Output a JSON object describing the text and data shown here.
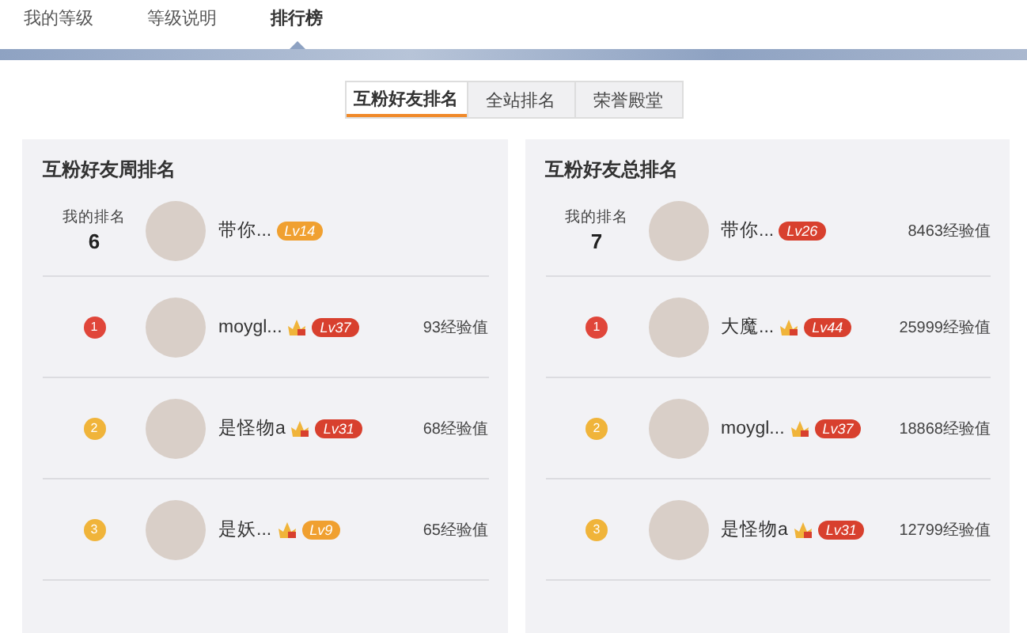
{
  "tabs": [
    {
      "label": "我的等级",
      "selected": false
    },
    {
      "label": "等级说明",
      "selected": false
    },
    {
      "label": "排行榜",
      "selected": true
    }
  ],
  "segments": [
    {
      "label": "互粉好友排名",
      "selected": true
    },
    {
      "label": "全站排名",
      "selected": false
    },
    {
      "label": "荣誉殿堂",
      "selected": false
    }
  ],
  "panels": [
    {
      "title": "互粉好友周排名",
      "my_rank": {
        "label": "我的排名",
        "rank": "6",
        "name": "带你...",
        "level": {
          "text": "Lv14",
          "color": "#f0a030"
        }
      },
      "rows": [
        {
          "rank": {
            "text": "1",
            "color": "#e0463a"
          },
          "name": "moygl...",
          "vip": true,
          "level": {
            "text": "Lv37",
            "color": "#d8402e"
          },
          "exp": "93经验值"
        },
        {
          "rank": {
            "text": "2",
            "color": "#f0b43a"
          },
          "name": "是怪物a",
          "vip": true,
          "level": {
            "text": "Lv31",
            "color": "#d8402e"
          },
          "exp": "68经验值"
        },
        {
          "rank": {
            "text": "3",
            "color": "#f0b43a"
          },
          "name": "是妖...",
          "vip": true,
          "level": {
            "text": "Lv9",
            "color": "#f0a030"
          },
          "exp": "65经验值"
        }
      ]
    },
    {
      "title": "互粉好友总排名",
      "my_rank": {
        "label": "我的排名",
        "rank": "7",
        "name": "带你...",
        "level": {
          "text": "Lv26",
          "color": "#d8402e"
        },
        "exp": "8463经验值"
      },
      "rows": [
        {
          "rank": {
            "text": "1",
            "color": "#e0463a"
          },
          "name": "大魔...",
          "vip": true,
          "level": {
            "text": "Lv44",
            "color": "#d8402e"
          },
          "exp": "25999经验值"
        },
        {
          "rank": {
            "text": "2",
            "color": "#f0b43a"
          },
          "name": "moygl...",
          "vip": true,
          "level": {
            "text": "Lv37",
            "color": "#d8402e"
          },
          "exp": "18868经验值"
        },
        {
          "rank": {
            "text": "3",
            "color": "#f0b43a"
          },
          "name": "是怪物a",
          "vip": true,
          "level": {
            "text": "Lv31",
            "color": "#d8402e"
          },
          "exp": "12799经验值"
        }
      ]
    }
  ]
}
